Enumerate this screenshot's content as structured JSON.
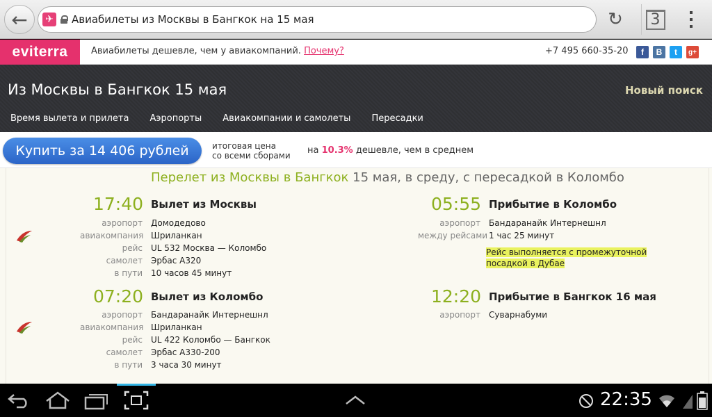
{
  "browser": {
    "url_title": "Авиабилеты из Москвы в Бангкок на 15 мая",
    "tabs_count": "3"
  },
  "site": {
    "logo": "eviterra",
    "tagline": "Авиабилеты дешевле, чем у авиакомпаний.",
    "tagline_link": "Почему?",
    "phone": "+7 495 660-35-20",
    "social": [
      "f",
      "В",
      "t",
      "g+"
    ]
  },
  "header": {
    "title": "Из Москвы в Бангкок 15 мая",
    "new_search": "Новый поиск",
    "nav": [
      "Время вылета и прилета",
      "Аэропорты",
      "Авиакомпании и самолеты",
      "Пересадки"
    ]
  },
  "buy": {
    "button": "Купить за 14 406 рублей",
    "note_line1": "итоговая цена",
    "note_line2": "со всеми сборами",
    "cheaper_prefix": "на",
    "cheaper_percent": "10.3%",
    "cheaper_suffix": "дешевле, чем в среднем"
  },
  "flight": {
    "title_green": "Перелет из Москвы в Бангкок",
    "title_rest": "15 мая, в среду, с пересадкой в Коломбо",
    "segments": [
      {
        "dep_time": "17:40",
        "dep_label": "Вылет из Москвы",
        "rows": [
          {
            "k": "аэропорт",
            "v": "Домодедово"
          },
          {
            "k": "авиакомпания",
            "v": "Шриланкан"
          },
          {
            "k": "рейс",
            "v": "UL 532 Москва — Коломбо"
          },
          {
            "k": "самолет",
            "v": "Эрбас A320"
          },
          {
            "k": "в пути",
            "v": "10 часов 45 минут"
          }
        ],
        "arr_time": "05:55",
        "arr_label": "Прибытие в Коломбо",
        "arr_rows": [
          {
            "k": "аэропорт",
            "v": "Бандаранайк Интернешнл"
          },
          {
            "k": "между рейсами",
            "v": "1 час 25 минут"
          }
        ],
        "note": "Рейс выполняется с промежуточной посадкой в Дубае"
      },
      {
        "dep_time": "07:20",
        "dep_label": "Вылет из Коломбо",
        "rows": [
          {
            "k": "аэропорт",
            "v": "Бандаранайк Интернешнл"
          },
          {
            "k": "авиакомпания",
            "v": "Шриланкан"
          },
          {
            "k": "рейс",
            "v": "UL 422 Коломбо — Бангкок"
          },
          {
            "k": "самолет",
            "v": "Эрбас A330-200"
          },
          {
            "k": "в пути",
            "v": "3 часа 30 минут"
          }
        ],
        "arr_time": "12:20",
        "arr_label": "Прибытие в Бангкок 16 мая",
        "arr_rows": [
          {
            "k": "аэропорт",
            "v": "Суварнабуми"
          }
        ]
      }
    ]
  },
  "system": {
    "clock": "22:35"
  },
  "colors": {
    "brand": "#e5316d",
    "accent_green": "#8db01f",
    "buy_button": "#3a7bd8",
    "highlight": "#e9f25e"
  }
}
